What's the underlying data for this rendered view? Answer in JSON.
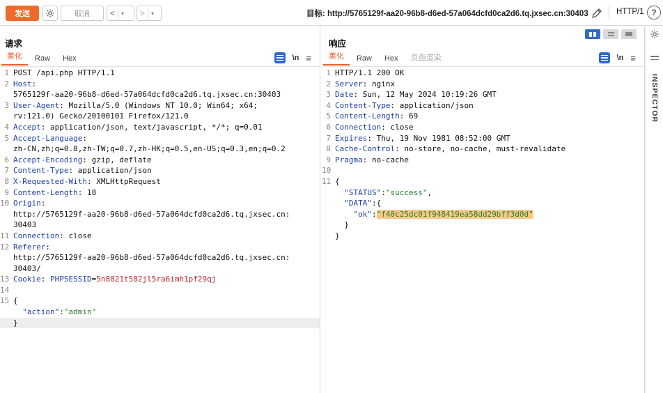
{
  "toolbar": {
    "send_label": "发送",
    "cancel_label": "取消",
    "back_glyph": "<",
    "forward_glyph": ">",
    "dropdown_glyph": "▾",
    "target_label": "目标: http://5765129f-aa20-96b8-d6ed-57a064dcfd0ca2d6.tq.jxsec.cn:30403",
    "http_version": "HTTP/1",
    "help_glyph": "?"
  },
  "request": {
    "title": "请求",
    "tabs": [
      "美化",
      "Raw",
      "Hex"
    ],
    "active_tab": "美化",
    "newline_label": "\\n",
    "lines": [
      {
        "n": "1",
        "parts": [
          [
            "t",
            "POST /api.php HTTP/1.1"
          ]
        ]
      },
      {
        "n": "2",
        "parts": [
          [
            "hk",
            "Host"
          ],
          [
            "t",
            ":"
          ]
        ]
      },
      {
        "n": "",
        "parts": [
          [
            "t",
            "5765129f-aa20-96b8-d6ed-57a064dcfd0ca2d6.tq.jxsec.cn:30403"
          ]
        ]
      },
      {
        "n": "3",
        "parts": [
          [
            "hk",
            "User-Agent"
          ],
          [
            "t",
            ": Mozilla/5.0 (Windows NT 10.0; Win64; x64;"
          ]
        ]
      },
      {
        "n": "",
        "parts": [
          [
            "t",
            "rv:121.0) Gecko/20100101 Firefox/121.0"
          ]
        ]
      },
      {
        "n": "4",
        "parts": [
          [
            "hk",
            "Accept"
          ],
          [
            "t",
            ": application/json, text/javascript, */*; q=0.01"
          ]
        ]
      },
      {
        "n": "5",
        "parts": [
          [
            "hk",
            "Accept-Language"
          ],
          [
            "t",
            ":"
          ]
        ]
      },
      {
        "n": "",
        "parts": [
          [
            "t",
            "zh-CN,zh;q=0.8,zh-TW;q=0.7,zh-HK;q=0.5,en-US;q=0.3,en;q=0.2"
          ]
        ]
      },
      {
        "n": "6",
        "parts": [
          [
            "hk",
            "Accept-Encoding"
          ],
          [
            "t",
            ": gzip, deflate"
          ]
        ]
      },
      {
        "n": "7",
        "parts": [
          [
            "hk",
            "Content-Type"
          ],
          [
            "t",
            ": application/json"
          ]
        ]
      },
      {
        "n": "8",
        "parts": [
          [
            "hk",
            "X-Requested-With"
          ],
          [
            "t",
            ": XMLHttpRequest"
          ]
        ]
      },
      {
        "n": "9",
        "parts": [
          [
            "hk",
            "Content-Length"
          ],
          [
            "t",
            ": 18"
          ]
        ]
      },
      {
        "n": "10",
        "parts": [
          [
            "hk",
            "Origin"
          ],
          [
            "t",
            ":"
          ]
        ]
      },
      {
        "n": "",
        "parts": [
          [
            "t",
            "http://5765129f-aa20-96b8-d6ed-57a064dcfd0ca2d6.tq.jxsec.cn:"
          ]
        ]
      },
      {
        "n": "",
        "parts": [
          [
            "t",
            "30403"
          ]
        ]
      },
      {
        "n": "11",
        "parts": [
          [
            "hk",
            "Connection"
          ],
          [
            "t",
            ": close"
          ]
        ]
      },
      {
        "n": "12",
        "parts": [
          [
            "hk",
            "Referer"
          ],
          [
            "t",
            ":"
          ]
        ]
      },
      {
        "n": "",
        "parts": [
          [
            "t",
            "http://5765129f-aa20-96b8-d6ed-57a064dcfd0ca2d6.tq.jxsec.cn:"
          ]
        ]
      },
      {
        "n": "",
        "parts": [
          [
            "t",
            "30403/"
          ]
        ]
      },
      {
        "n": "13",
        "parts": [
          [
            "hk",
            "Cookie"
          ],
          [
            "t",
            ": "
          ],
          [
            "ck",
            "PHPSESSID"
          ],
          [
            "t",
            "="
          ],
          [
            "cv",
            "5n8821t582jl5ra6imh1pf29qj"
          ]
        ]
      },
      {
        "n": "14",
        "parts": []
      },
      {
        "n": "15",
        "parts": [
          [
            "t",
            "{"
          ]
        ]
      },
      {
        "n": "",
        "parts": [
          [
            "t",
            "  "
          ],
          [
            "js",
            "\"action\""
          ],
          [
            "t",
            ":"
          ],
          [
            "jv",
            "\"admin\""
          ]
        ]
      },
      {
        "n": "",
        "parts": [
          [
            "t",
            "}"
          ]
        ],
        "cursor": true
      }
    ]
  },
  "response": {
    "title": "响应",
    "tabs": [
      "美化",
      "Raw",
      "Hex",
      "页面渲染"
    ],
    "active_tab": "美化",
    "newline_label": "\\n",
    "lines": [
      {
        "n": "1",
        "parts": [
          [
            "t",
            "HTTP/1.1 200 OK"
          ]
        ]
      },
      {
        "n": "2",
        "parts": [
          [
            "hk",
            "Server"
          ],
          [
            "t",
            ": nginx"
          ]
        ]
      },
      {
        "n": "3",
        "parts": [
          [
            "hk",
            "Date"
          ],
          [
            "t",
            ": Sun, 12 May 2024 10:19:26 GMT"
          ]
        ]
      },
      {
        "n": "4",
        "parts": [
          [
            "hk",
            "Content-Type"
          ],
          [
            "t",
            ": application/json"
          ]
        ]
      },
      {
        "n": "5",
        "parts": [
          [
            "hk",
            "Content-Length"
          ],
          [
            "t",
            ": 69"
          ]
        ]
      },
      {
        "n": "6",
        "parts": [
          [
            "hk",
            "Connection"
          ],
          [
            "t",
            ": close"
          ]
        ]
      },
      {
        "n": "7",
        "parts": [
          [
            "hk",
            "Expires"
          ],
          [
            "t",
            ": Thu, 19 Nov 1981 08:52:00 GMT"
          ]
        ]
      },
      {
        "n": "8",
        "parts": [
          [
            "hk",
            "Cache-Control"
          ],
          [
            "t",
            ": no-store, no-cache, must-revalidate"
          ]
        ]
      },
      {
        "n": "9",
        "parts": [
          [
            "hk",
            "Pragma"
          ],
          [
            "t",
            ": no-cache"
          ]
        ]
      },
      {
        "n": "10",
        "parts": []
      },
      {
        "n": "11",
        "parts": [
          [
            "t",
            "{"
          ]
        ]
      },
      {
        "n": "",
        "parts": [
          [
            "t",
            "  "
          ],
          [
            "js",
            "\"STATUS\""
          ],
          [
            "t",
            ":"
          ],
          [
            "jv",
            "\"success\""
          ],
          [
            "t",
            ","
          ]
        ]
      },
      {
        "n": "",
        "parts": [
          [
            "t",
            "  "
          ],
          [
            "js",
            "\"DATA\""
          ],
          [
            "t",
            ":{"
          ]
        ]
      },
      {
        "n": "",
        "parts": [
          [
            "t",
            "    "
          ],
          [
            "js",
            "\"ok\""
          ],
          [
            "t",
            ":"
          ],
          [
            "hl",
            "\"f40c25dc01f948419ea58dd29bff3d0d\""
          ]
        ]
      },
      {
        "n": "",
        "parts": [
          [
            "t",
            "  }"
          ]
        ]
      },
      {
        "n": "",
        "parts": [
          [
            "t",
            "}"
          ]
        ]
      }
    ]
  },
  "inspector_label": "INSPECTOR",
  "colors": {
    "accent": "#ef6a2a",
    "header_key": "#1b3fa7",
    "cookie_value": "#c0262d",
    "json_value": "#2e7d32",
    "highlight": "#f6c987",
    "toggle_active": "#2f6bc9"
  }
}
